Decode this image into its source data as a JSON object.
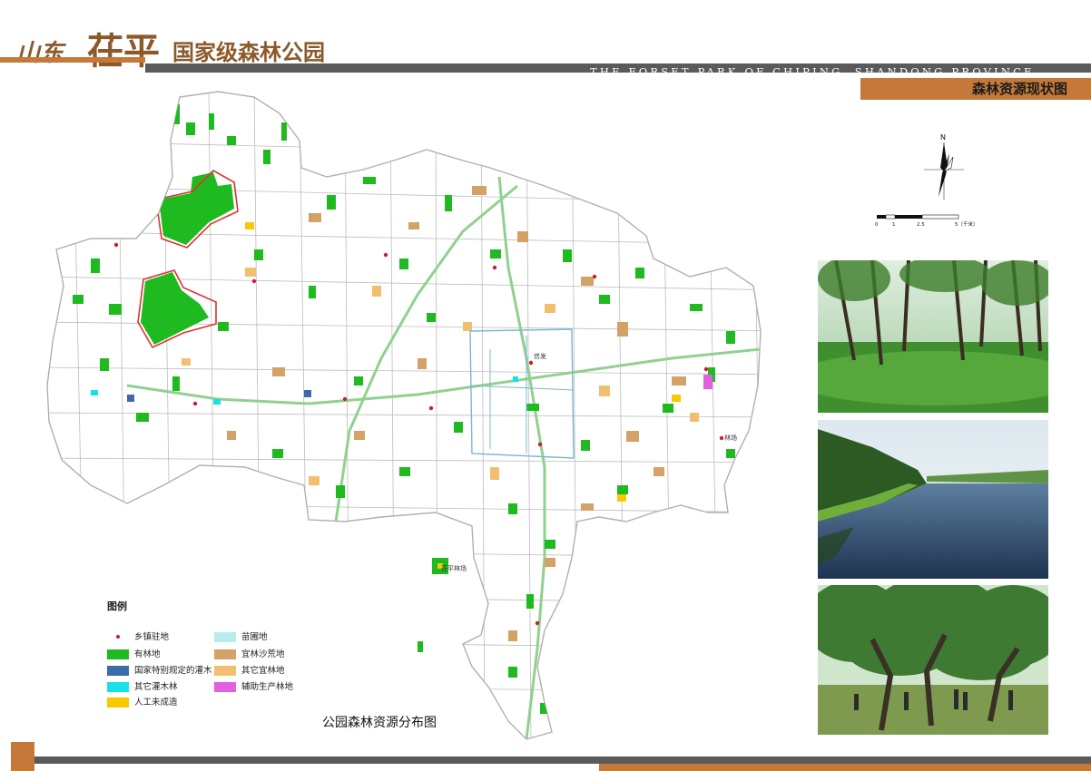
{
  "header": {
    "title_cn_parts": [
      "山东",
      "茌平",
      "国家级森林公园"
    ],
    "subtitle_en": "THE FORSET PARK OF CHIPING, SHANDONG PROVINCE",
    "sheet_title": "森林资源现状图"
  },
  "map": {
    "caption": "公园森林资源分布图",
    "place_labels": [
      "信发",
      "茌平林场",
      "林场"
    ],
    "north_label": "N",
    "scale_ticks": [
      "0",
      "1",
      "2.5",
      "5（千米）"
    ]
  },
  "legend": {
    "title": "图例",
    "items": [
      {
        "label": "乡镇驻地",
        "type": "dot",
        "color": "#c8202a"
      },
      {
        "label": "苗圃地",
        "type": "swatch",
        "color": "#b6ecec"
      },
      {
        "label": "有林地",
        "type": "swatch",
        "color": "#1fba1f"
      },
      {
        "label": "宜林沙荒地",
        "type": "swatch",
        "color": "#d4a266"
      },
      {
        "label": "国家特别规定的灌木",
        "type": "swatch",
        "color": "#3e6aa8"
      },
      {
        "label": "其它宜林地",
        "type": "swatch",
        "color": "#f0c070"
      },
      {
        "label": "其它灌木林",
        "type": "swatch",
        "color": "#18e0e8"
      },
      {
        "label": "辅助生产林地",
        "type": "swatch",
        "color": "#e060e0"
      },
      {
        "label": "人工未成造",
        "type": "swatch",
        "color": "#f8c800"
      }
    ]
  },
  "colors": {
    "accent_orange": "#c4793b",
    "band_gray": "#5a5a5a",
    "forest_green": "#1fba1f",
    "road_gray": "#9a9a9a"
  },
  "photos": [
    {
      "icon": "forest-photo"
    },
    {
      "icon": "river-photo"
    },
    {
      "icon": "orchard-photo"
    }
  ]
}
